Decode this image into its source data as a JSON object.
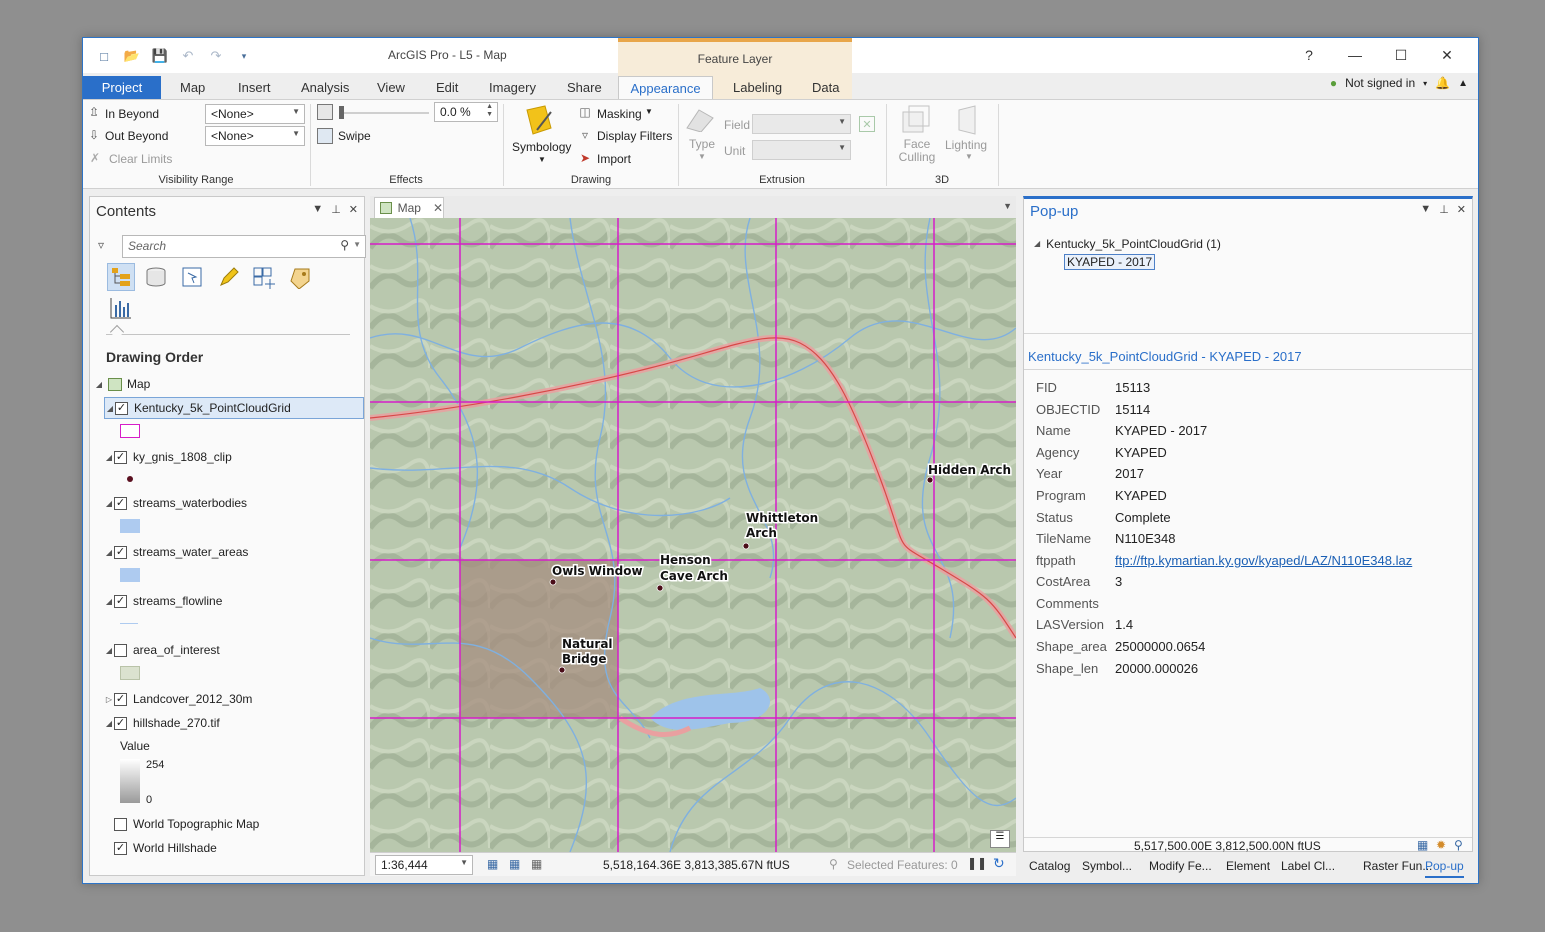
{
  "window": {
    "app_title": "ArcGIS Pro - L5 - Map",
    "context_title": "Feature Layer",
    "signin": "Not signed in",
    "help": "?"
  },
  "tabs": [
    "Project",
    "Map",
    "Insert",
    "Analysis",
    "View",
    "Edit",
    "Imagery",
    "Share",
    "Appearance",
    "Labeling",
    "Data"
  ],
  "ribbon": {
    "visibility": {
      "in_beyond": "In Beyond",
      "out_beyond": "Out Beyond",
      "clear_limits": "Clear Limits",
      "in_value": "<None>",
      "out_value": "<None>",
      "label": "Visibility Range"
    },
    "effects": {
      "transparency": "0.0 %",
      "swipe": "Swipe",
      "label": "Effects"
    },
    "drawing": {
      "symbology": "Symbology",
      "masking": "Masking",
      "display_filters": "Display Filters",
      "import": "Import",
      "label": "Drawing"
    },
    "extrusion": {
      "type": "Type",
      "field": "Field",
      "unit": "Unit",
      "label": "Extrusion"
    },
    "three_d": {
      "face_culling": "Face Culling",
      "lighting": "Lighting",
      "label": "3D"
    }
  },
  "contents": {
    "title": "Contents",
    "search_placeholder": "Search",
    "heading": "Drawing Order",
    "map_node": "Map",
    "layers": [
      {
        "name": "Kentucky_5k_PointCloudGrid",
        "checked": true
      },
      {
        "name": "ky_gnis_1808_clip",
        "checked": true
      },
      {
        "name": "streams_waterbodies",
        "checked": true
      },
      {
        "name": "streams_water_areas",
        "checked": true
      },
      {
        "name": "streams_flowline",
        "checked": true
      },
      {
        "name": "area_of_interest",
        "checked": false
      },
      {
        "name": "Landcover_2012_30m",
        "checked": true
      },
      {
        "name": "hillshade_270.tif",
        "checked": true
      },
      {
        "name": "World Topographic Map",
        "checked": false
      },
      {
        "name": "World Hillshade",
        "checked": true
      }
    ],
    "hillshade_legend": {
      "title": "Value",
      "max": "254",
      "min": "0"
    }
  },
  "map": {
    "tab_label": "Map",
    "scale": "1:36,444",
    "coords": "5,518,164.36E 3,813,385.67N ftUS",
    "selected": "Selected Features: 0",
    "places": [
      {
        "name": "Hidden Arch"
      },
      {
        "name": "Whittleton Arch"
      },
      {
        "name": "Henson Cave Arch"
      },
      {
        "name": "Owls Window"
      },
      {
        "name": "Natural Bridge"
      }
    ]
  },
  "popup": {
    "title": "Pop-up",
    "tree_layer": "Kentucky_5k_PointCloudGrid  (1)",
    "tree_feature": "KYAPED - 2017",
    "header": "Kentucky_5k_PointCloudGrid - KYAPED - 2017",
    "fields": [
      {
        "k": "FID",
        "v": "15113"
      },
      {
        "k": "OBJECTID",
        "v": "15114"
      },
      {
        "k": "Name",
        "v": "KYAPED - 2017"
      },
      {
        "k": "Agency",
        "v": "KYAPED"
      },
      {
        "k": "Year",
        "v": "2017"
      },
      {
        "k": "Program",
        "v": "KYAPED"
      },
      {
        "k": "Status",
        "v": "Complete"
      },
      {
        "k": "TileName",
        "v": "N110E348"
      },
      {
        "k": "ftppath",
        "v": "ftp://ftp.kymartian.ky.gov/kyaped/LAZ/N110E348.laz"
      },
      {
        "k": "CostArea",
        "v": "3"
      },
      {
        "k": "Comments",
        "v": ""
      },
      {
        "k": "LASVersion",
        "v": "1.4"
      },
      {
        "k": "Shape_area",
        "v": "25000000.0654"
      },
      {
        "k": "Shape_len",
        "v": "20000.000026"
      }
    ],
    "coords": "5,517,500.00E 3,812,500.00N ftUS"
  },
  "bottom_tabs": [
    "Catalog",
    "Symbol...",
    "Modify Fe...",
    "Element",
    "Label Cl...",
    "Raster Fun...",
    "Pop-up"
  ],
  "colors": {
    "accent": "#2a6fc9",
    "grid": "#d61ec8",
    "context": "#f7ecd9"
  }
}
